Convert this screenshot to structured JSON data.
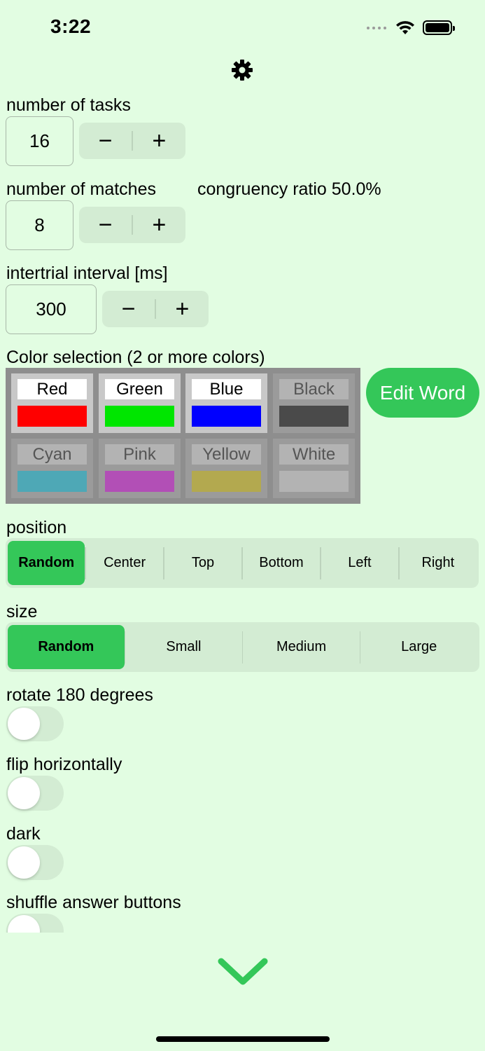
{
  "status_bar": {
    "time": "3:22"
  },
  "icons": {
    "settings": "gear-icon",
    "next": "chevron-down-icon"
  },
  "tasks": {
    "label": "number of tasks",
    "value": "16",
    "minus": "−",
    "plus": "+"
  },
  "matches": {
    "label": "number of matches",
    "value": "8",
    "minus": "−",
    "plus": "+",
    "ratio_text": "congruency ratio 50.0%"
  },
  "interval": {
    "label": "intertrial interval [ms]",
    "value": "300",
    "minus": "−",
    "plus": "+"
  },
  "colors": {
    "label": "Color selection (2 or more colors)",
    "items": [
      {
        "name": "Red",
        "swatch": "#ff0000",
        "selected": true
      },
      {
        "name": "Green",
        "swatch": "#00e600",
        "selected": true
      },
      {
        "name": "Blue",
        "swatch": "#0000ff",
        "selected": true
      },
      {
        "name": "Black",
        "swatch": "#4a4a4a",
        "selected": false
      },
      {
        "name": "Cyan",
        "swatch": "#4ea8b6",
        "selected": false
      },
      {
        "name": "Pink",
        "swatch": "#b24fb6",
        "selected": false
      },
      {
        "name": "Yellow",
        "swatch": "#b3a94f",
        "selected": false
      },
      {
        "name": "White",
        "swatch": "#b3b3b3",
        "selected": false
      }
    ],
    "edit_word": "Edit Word"
  },
  "position": {
    "label": "position",
    "options": [
      "Random",
      "Center",
      "Top",
      "Bottom",
      "Left",
      "Right"
    ],
    "selected": "Random"
  },
  "size": {
    "label": "size",
    "options": [
      "Random",
      "Small",
      "Medium",
      "Large"
    ],
    "selected": "Random"
  },
  "toggles": {
    "rotate": {
      "label": "rotate 180 degrees",
      "on": false
    },
    "flip": {
      "label": "flip horizontally",
      "on": false
    },
    "dark": {
      "label": "dark",
      "on": false
    },
    "shuffle": {
      "label": "shuffle answer buttons",
      "on": false
    }
  },
  "theme": {
    "accent": "#34c759",
    "background": "#e2fde2",
    "control": "#d3ecd3"
  }
}
